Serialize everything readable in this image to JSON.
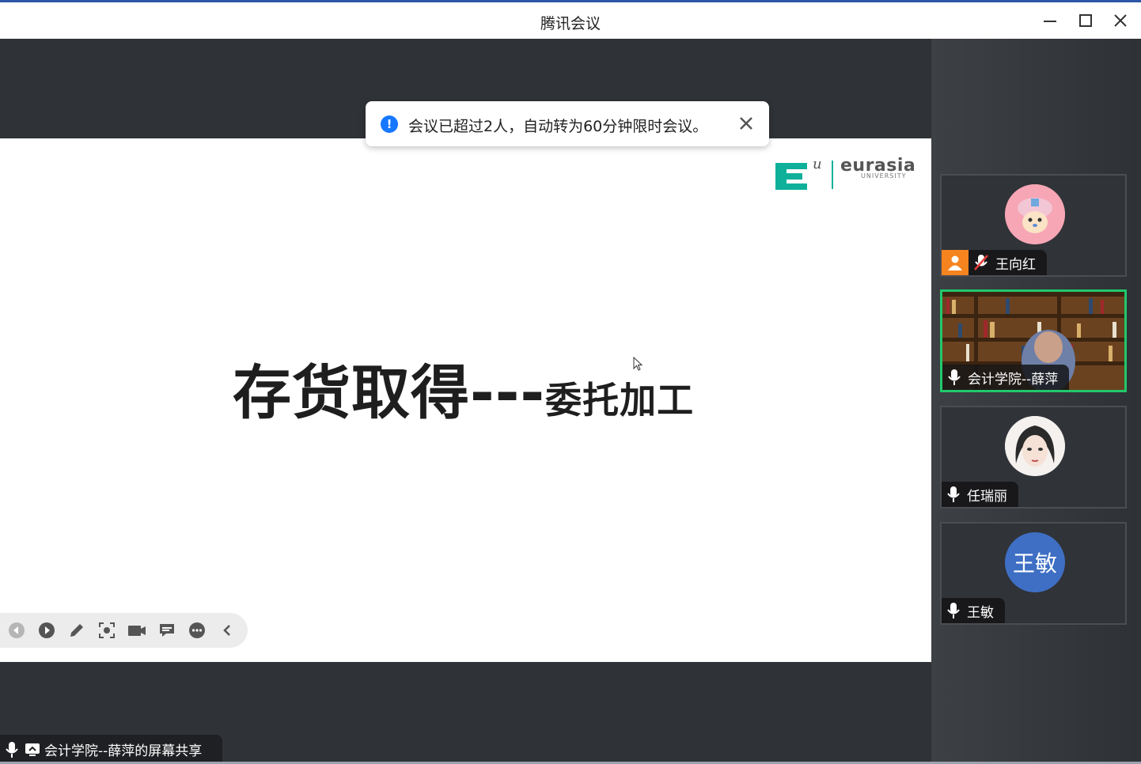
{
  "window": {
    "title": "腾讯会议"
  },
  "notification": {
    "text": "会议已超过2人，自动转为60分钟限时会议。"
  },
  "slide": {
    "title_main": "存货取得---",
    "title_sub": "委托加工",
    "logo_text": "eurasia",
    "logo_subtext": "UNIVERSITY",
    "logo_mark": "E",
    "logo_superscript": "u"
  },
  "share": {
    "label": "会计学院--薛萍的屏幕共享"
  },
  "participants": [
    {
      "name": "王向红",
      "muted": true,
      "has_person_badge": true
    },
    {
      "name": "会计学院--薛萍",
      "muted": false,
      "speaking": true
    },
    {
      "name": "任瑞丽",
      "muted": false
    },
    {
      "name": "王敏",
      "muted": false,
      "avatar_text": "王敏"
    }
  ],
  "colors": {
    "accent_green": "#21c86b",
    "info_blue": "#1677ff",
    "badge_orange": "#f5841f",
    "avatar_blue": "#3e6fc4"
  }
}
